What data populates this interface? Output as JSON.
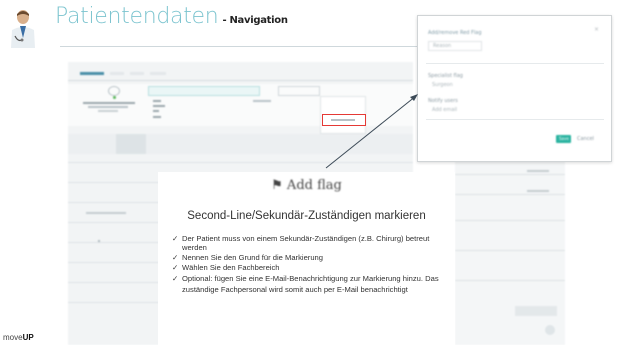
{
  "header": {
    "title": "Patientendaten",
    "subtitle": "- Navigation"
  },
  "popup": {
    "title": "Add/remove Red Flag",
    "placeholder": "Reason",
    "section1_label": "Specialist flag",
    "option1": "Surgeon",
    "section2_label": "Notify users",
    "option2": "Add email",
    "save_label": "Save",
    "cancel_label": "Cancel"
  },
  "card": {
    "add_flag": "⚑ Add flag",
    "heading": "Second-Line/Sekundär-Zuständigen markieren",
    "bullets": [
      "Der Patient muss von einem Sekundär-Zuständigen (z.B. Chirurg) betreut werden",
      "Nennen Sie den Grund für die Markierung",
      "Wählen Sie den Fachbereich",
      "Optional: fügen Sie eine E-Mail-Benachrichtigung zur Markierung hinzu. Das zuständige Fachpersonal wird somit auch per E-Mail benachrichtigt"
    ]
  },
  "logo": {
    "prefix": "move",
    "suffix": "UP"
  },
  "colors": {
    "title": "#7cc4cf",
    "highlight": "#e53935",
    "save_button": "#29b3a0"
  }
}
